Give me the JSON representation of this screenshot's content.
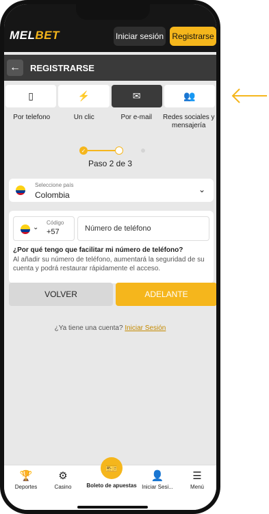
{
  "brand": {
    "logo_text_1": "MEL",
    "logo_text_2": "BET"
  },
  "header": {
    "login_label": "Iniciar sesión",
    "register_label": "Registrarse"
  },
  "titlebar": {
    "title": "REGISTRARSE",
    "back_icon": "←"
  },
  "tabs": [
    {
      "label": "Por telefono",
      "icon": "▯",
      "icon_name": "phone-icon"
    },
    {
      "label": "Un clic",
      "icon": "⚡",
      "icon_name": "lightning-icon"
    },
    {
      "label": "Por e-mail",
      "icon": "✉",
      "icon_name": "mail-icon"
    },
    {
      "label": "Redes sociales y mensajería",
      "icon": "👥",
      "icon_name": "people-icon"
    }
  ],
  "steps": {
    "text": "Paso 2 de 3",
    "check": "✓"
  },
  "country": {
    "label": "Seleccione país",
    "value": "Colombia"
  },
  "phone": {
    "code_label": "Código",
    "code_value": "+57",
    "placeholder": "Número de teléfono"
  },
  "info": {
    "question": "¿Por qué tengo que facilitar mi número de teléfono?",
    "text": "Al añadir su número de teléfono, aumentará la seguridad de su cuenta y podrá restaurar rápidamente el acceso."
  },
  "buttons": {
    "back": "VOLVER",
    "next": "ADELANTE"
  },
  "account": {
    "text": "¿Ya tiene una cuenta?",
    "link": "Iniciar Sesión"
  },
  "nav": [
    {
      "label": "Deportes",
      "icon": "🏆"
    },
    {
      "label": "Casino",
      "icon": "⚙"
    },
    {
      "label": "Boleto de apuestas",
      "icon": "🎫"
    },
    {
      "label": "Iniciar Sesi...",
      "icon": "👤"
    },
    {
      "label": "Menú",
      "icon": "☰"
    }
  ],
  "colors": {
    "accent": "#f5b61c",
    "header": "#161616",
    "titlebar": "#3a3a3a"
  }
}
